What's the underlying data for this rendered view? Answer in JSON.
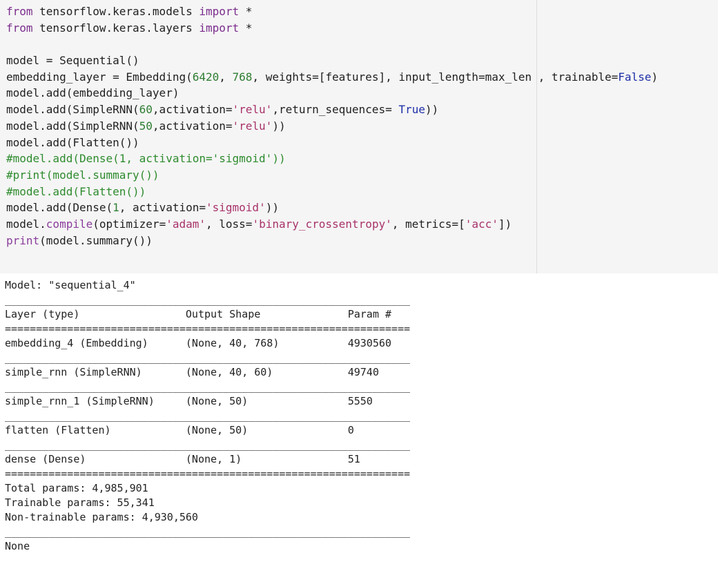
{
  "input_cell": {
    "code_lines": [
      [
        {
          "t": "from",
          "c": "kw"
        },
        {
          "t": " tensorflow.keras.models ",
          "c": "pl"
        },
        {
          "t": "import",
          "c": "kw"
        },
        {
          "t": " *",
          "c": "pl"
        }
      ],
      [
        {
          "t": "from",
          "c": "kw"
        },
        {
          "t": " tensorflow.keras.layers ",
          "c": "pl"
        },
        {
          "t": "import",
          "c": "kw"
        },
        {
          "t": " *",
          "c": "pl"
        }
      ],
      [
        {
          "t": "",
          "c": "pl"
        }
      ],
      [
        {
          "t": "model = Sequential()",
          "c": "pl"
        }
      ],
      [
        {
          "t": "embedding_layer = Embedding(",
          "c": "pl"
        },
        {
          "t": "6420",
          "c": "num"
        },
        {
          "t": ", ",
          "c": "pl"
        },
        {
          "t": "768",
          "c": "num"
        },
        {
          "t": ", weights=[features], input_length=max_len , trainable=",
          "c": "pl"
        },
        {
          "t": "False",
          "c": "const"
        },
        {
          "t": ")",
          "c": "pl"
        }
      ],
      [
        {
          "t": "model.add(embedding_layer)",
          "c": "pl"
        }
      ],
      [
        {
          "t": "model.add(SimpleRNN(",
          "c": "pl"
        },
        {
          "t": "60",
          "c": "num"
        },
        {
          "t": ",activation=",
          "c": "pl"
        },
        {
          "t": "'relu'",
          "c": "str"
        },
        {
          "t": ",return_sequences= ",
          "c": "pl"
        },
        {
          "t": "True",
          "c": "const"
        },
        {
          "t": "))",
          "c": "pl"
        }
      ],
      [
        {
          "t": "model.add(SimpleRNN(",
          "c": "pl"
        },
        {
          "t": "50",
          "c": "num"
        },
        {
          "t": ",activation=",
          "c": "pl"
        },
        {
          "t": "'relu'",
          "c": "str"
        },
        {
          "t": "))",
          "c": "pl"
        }
      ],
      [
        {
          "t": "model.add(Flatten())",
          "c": "pl"
        }
      ],
      [
        {
          "t": "#model.add(Dense(1, activation='sigmoid'))",
          "c": "com"
        }
      ],
      [
        {
          "t": "#print(model.summary())",
          "c": "com"
        }
      ],
      [
        {
          "t": "#model.add(Flatten())",
          "c": "com"
        }
      ],
      [
        {
          "t": "model.add(Dense(",
          "c": "pl"
        },
        {
          "t": "1",
          "c": "num"
        },
        {
          "t": ", activation=",
          "c": "pl"
        },
        {
          "t": "'sigmoid'",
          "c": "str"
        },
        {
          "t": "))",
          "c": "pl"
        }
      ],
      [
        {
          "t": "model.",
          "c": "pl"
        },
        {
          "t": "compile",
          "c": "bi"
        },
        {
          "t": "(optimizer=",
          "c": "pl"
        },
        {
          "t": "'adam'",
          "c": "str"
        },
        {
          "t": ", loss=",
          "c": "pl"
        },
        {
          "t": "'binary_crossentropy'",
          "c": "str"
        },
        {
          "t": ", metrics=[",
          "c": "pl"
        },
        {
          "t": "'acc'",
          "c": "str"
        },
        {
          "t": "])",
          "c": "pl"
        }
      ],
      [
        {
          "t": "print",
          "c": "bi"
        },
        {
          "t": "(model.summary())",
          "c": "pl"
        }
      ]
    ]
  },
  "output_cell": {
    "lines": [
      "Model: \"sequential_4\"",
      "_________________________________________________________________",
      "Layer (type)                 Output Shape              Param #   ",
      "=================================================================",
      "embedding_4 (Embedding)      (None, 40, 768)           4930560   ",
      "_________________________________________________________________",
      "simple_rnn (SimpleRNN)       (None, 40, 60)            49740     ",
      "_________________________________________________________________",
      "simple_rnn_1 (SimpleRNN)     (None, 50)                5550      ",
      "_________________________________________________________________",
      "flatten (Flatten)            (None, 50)                0         ",
      "_________________________________________________________________",
      "dense (Dense)                (None, 1)                 51        ",
      "=================================================================",
      "Total params: 4,985,901",
      "Trainable params: 55,341",
      "Non-trainable params: 4,930,560",
      "_________________________________________________________________",
      "None"
    ]
  },
  "colors": {
    "keyword": "#7a2d8c",
    "number": "#2e7d32",
    "string": "#a8326a",
    "constant": "#1f2fa8",
    "comment": "#2e8b2e",
    "input_background": "#f5f5f5"
  }
}
